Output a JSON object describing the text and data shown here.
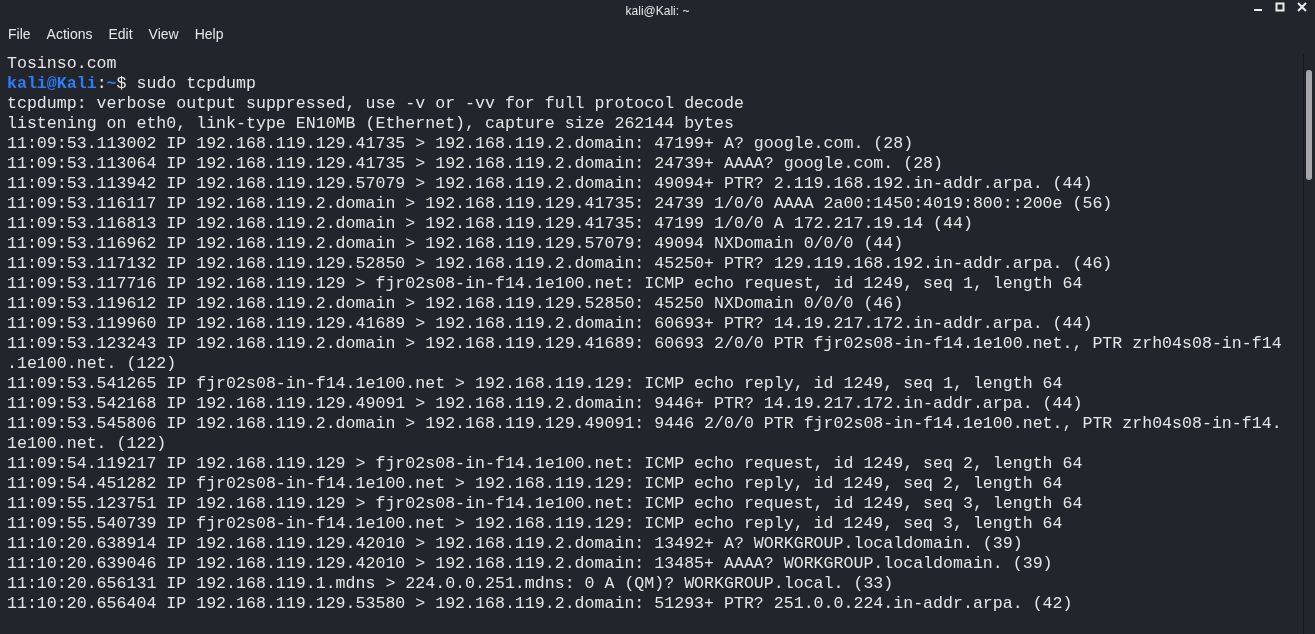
{
  "window": {
    "title": "kali@Kali: ~"
  },
  "menu": [
    "File",
    "Actions",
    "Edit",
    "View",
    "Help"
  ],
  "terminal": {
    "lines": [
      {
        "kind": "output",
        "text": "Tosinso.com"
      },
      {
        "kind": "prompt",
        "user": "kali@Kali",
        "separator": ":",
        "path": "~",
        "symbol": "$",
        "command": "sudo tcpdump"
      },
      {
        "kind": "output",
        "text": "tcpdump: verbose output suppressed, use -v or -vv for full protocol decode"
      },
      {
        "kind": "output",
        "text": "listening on eth0, link-type EN10MB (Ethernet), capture size 262144 bytes"
      },
      {
        "kind": "output",
        "text": "11:09:53.113002 IP 192.168.119.129.41735 > 192.168.119.2.domain: 47199+ A? google.com. (28)"
      },
      {
        "kind": "output",
        "text": "11:09:53.113064 IP 192.168.119.129.41735 > 192.168.119.2.domain: 24739+ AAAA? google.com. (28)"
      },
      {
        "kind": "output",
        "text": "11:09:53.113942 IP 192.168.119.129.57079 > 192.168.119.2.domain: 49094+ PTR? 2.119.168.192.in-addr.arpa. (44)"
      },
      {
        "kind": "output",
        "text": "11:09:53.116117 IP 192.168.119.2.domain > 192.168.119.129.41735: 24739 1/0/0 AAAA 2a00:1450:4019:800::200e (56)"
      },
      {
        "kind": "output",
        "text": "11:09:53.116813 IP 192.168.119.2.domain > 192.168.119.129.41735: 47199 1/0/0 A 172.217.19.14 (44)"
      },
      {
        "kind": "output",
        "text": "11:09:53.116962 IP 192.168.119.2.domain > 192.168.119.129.57079: 49094 NXDomain 0/0/0 (44)"
      },
      {
        "kind": "output",
        "text": "11:09:53.117132 IP 192.168.119.129.52850 > 192.168.119.2.domain: 45250+ PTR? 129.119.168.192.in-addr.arpa. (46)"
      },
      {
        "kind": "output",
        "text": "11:09:53.117716 IP 192.168.119.129 > fjr02s08-in-f14.1e100.net: ICMP echo request, id 1249, seq 1, length 64"
      },
      {
        "kind": "output",
        "text": "11:09:53.119612 IP 192.168.119.2.domain > 192.168.119.129.52850: 45250 NXDomain 0/0/0 (46)"
      },
      {
        "kind": "output",
        "text": "11:09:53.119960 IP 192.168.119.129.41689 > 192.168.119.2.domain: 60693+ PTR? 14.19.217.172.in-addr.arpa. (44)"
      },
      {
        "kind": "output",
        "text": "11:09:53.123243 IP 192.168.119.2.domain > 192.168.119.129.41689: 60693 2/0/0 PTR fjr02s08-in-f14.1e100.net., PTR zrh04s08-in-f14"
      },
      {
        "kind": "output",
        "text": ".1e100.net. (122)"
      },
      {
        "kind": "output",
        "text": "11:09:53.541265 IP fjr02s08-in-f14.1e100.net > 192.168.119.129: ICMP echo reply, id 1249, seq 1, length 64"
      },
      {
        "kind": "output",
        "text": "11:09:53.542168 IP 192.168.119.129.49091 > 192.168.119.2.domain: 9446+ PTR? 14.19.217.172.in-addr.arpa. (44)"
      },
      {
        "kind": "output",
        "text": "11:09:53.545806 IP 192.168.119.2.domain > 192.168.119.129.49091: 9446 2/0/0 PTR fjr02s08-in-f14.1e100.net., PTR zrh04s08-in-f14."
      },
      {
        "kind": "output",
        "text": "1e100.net. (122)"
      },
      {
        "kind": "output",
        "text": "11:09:54.119217 IP 192.168.119.129 > fjr02s08-in-f14.1e100.net: ICMP echo request, id 1249, seq 2, length 64"
      },
      {
        "kind": "output",
        "text": "11:09:54.451282 IP fjr02s08-in-f14.1e100.net > 192.168.119.129: ICMP echo reply, id 1249, seq 2, length 64"
      },
      {
        "kind": "output",
        "text": "11:09:55.123751 IP 192.168.119.129 > fjr02s08-in-f14.1e100.net: ICMP echo request, id 1249, seq 3, length 64"
      },
      {
        "kind": "output",
        "text": "11:09:55.540739 IP fjr02s08-in-f14.1e100.net > 192.168.119.129: ICMP echo reply, id 1249, seq 3, length 64"
      },
      {
        "kind": "output",
        "text": "11:10:20.638914 IP 192.168.119.129.42010 > 192.168.119.2.domain: 13492+ A? WORKGROUP.localdomain. (39)"
      },
      {
        "kind": "output",
        "text": "11:10:20.639046 IP 192.168.119.129.42010 > 192.168.119.2.domain: 13485+ AAAA? WORKGROUP.localdomain. (39)"
      },
      {
        "kind": "output",
        "text": "11:10:20.656131 IP 192.168.119.1.mdns > 224.0.0.251.mdns: 0 A (QM)? WORKGROUP.local. (33)"
      },
      {
        "kind": "output",
        "text": "11:10:20.656404 IP 192.168.119.129.53580 > 192.168.119.2.domain: 51293+ PTR? 251.0.0.224.in-addr.arpa. (42)"
      }
    ]
  }
}
